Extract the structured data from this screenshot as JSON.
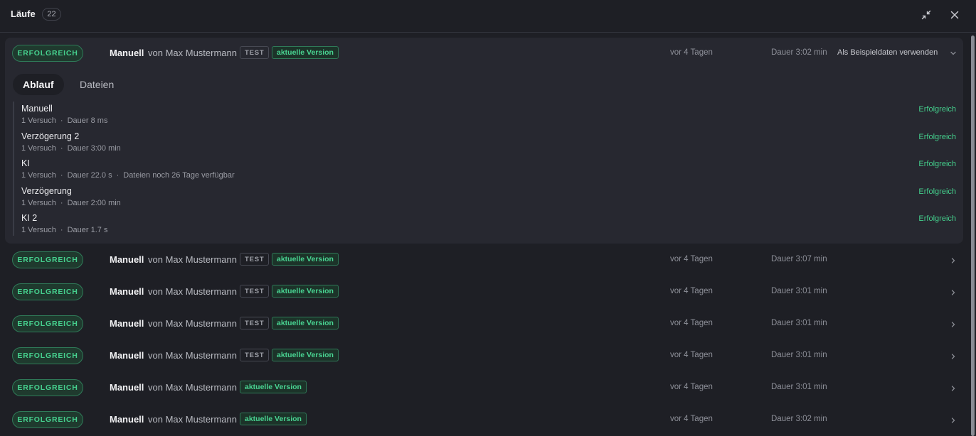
{
  "header": {
    "title": "Läufe",
    "count": "22"
  },
  "status_label": "ERFOLGREICH",
  "colors": {
    "background": "#1e1f25",
    "panel": "#272830",
    "success": "#46d08e"
  },
  "expanded_run": {
    "title": "Manuell",
    "by": "von Max Mustermann",
    "test_tag": "TEST",
    "version_tag": "aktuelle Version",
    "when": "vor 4 Tagen",
    "duration": "Dauer 3:02 min",
    "sample_action": "Als Beispieldaten verwenden",
    "tabs": [
      "Ablauf",
      "Dateien"
    ],
    "steps": [
      {
        "name": "Manuell",
        "attempts": "1 Versuch",
        "duration": "Dauer 8 ms",
        "extra": "",
        "status": "Erfolgreich"
      },
      {
        "name": "Verzögerung 2",
        "attempts": "1 Versuch",
        "duration": "Dauer 3:00 min",
        "extra": "",
        "status": "Erfolgreich"
      },
      {
        "name": "KI",
        "attempts": "1 Versuch",
        "duration": "Dauer 22.0 s",
        "extra": "Dateien noch 26 Tage verfügbar",
        "status": "Erfolgreich"
      },
      {
        "name": "Verzögerung",
        "attempts": "1 Versuch",
        "duration": "Dauer 2:00 min",
        "extra": "",
        "status": "Erfolgreich"
      },
      {
        "name": "KI 2",
        "attempts": "1 Versuch",
        "duration": "Dauer 1.7 s",
        "extra": "",
        "status": "Erfolgreich"
      }
    ]
  },
  "runs": [
    {
      "title": "Manuell",
      "by": "von Max Mustermann",
      "test_tag": "TEST",
      "version_tag": "aktuelle Version",
      "when": "vor 4 Tagen",
      "duration": "Dauer 3:07 min"
    },
    {
      "title": "Manuell",
      "by": "von Max Mustermann",
      "test_tag": "TEST",
      "version_tag": "aktuelle Version",
      "when": "vor 4 Tagen",
      "duration": "Dauer 3:01 min"
    },
    {
      "title": "Manuell",
      "by": "von Max Mustermann",
      "test_tag": "TEST",
      "version_tag": "aktuelle Version",
      "when": "vor 4 Tagen",
      "duration": "Dauer 3:01 min"
    },
    {
      "title": "Manuell",
      "by": "von Max Mustermann",
      "test_tag": "TEST",
      "version_tag": "aktuelle Version",
      "when": "vor 4 Tagen",
      "duration": "Dauer 3:01 min"
    },
    {
      "title": "Manuell",
      "by": "von Max Mustermann",
      "test_tag": "",
      "version_tag": "aktuelle Version",
      "when": "vor 4 Tagen",
      "duration": "Dauer 3:01 min"
    },
    {
      "title": "Manuell",
      "by": "von Max Mustermann",
      "test_tag": "",
      "version_tag": "aktuelle Version",
      "when": "vor 4 Tagen",
      "duration": "Dauer 3:02 min"
    }
  ]
}
